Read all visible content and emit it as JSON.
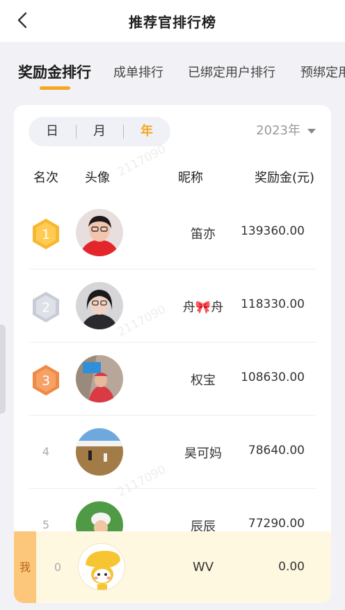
{
  "header": {
    "title": "推荐官排行榜"
  },
  "tabs": [
    {
      "label": "奖励金排行",
      "active": true
    },
    {
      "label": "成单排行",
      "active": false
    },
    {
      "label": "已绑定用户排行",
      "active": false
    },
    {
      "label": "预绑定用户排行",
      "active": false
    }
  ],
  "period": {
    "options": [
      "日",
      "月",
      "年"
    ],
    "selected": "年",
    "year": "2023年"
  },
  "table": {
    "headers": {
      "rank": "名次",
      "avatar": "头像",
      "nickname": "昵称",
      "amount": "奖励金(元)"
    },
    "rows": [
      {
        "rank": "1",
        "nickname": "笛亦",
        "amount": "139360.00"
      },
      {
        "rank": "2",
        "nickname": "舟🎀舟",
        "amount": "118330.00"
      },
      {
        "rank": "3",
        "nickname": "权宝",
        "amount": "108630.00"
      },
      {
        "rank": "4",
        "nickname": "昊可妈",
        "amount": "78640.00"
      },
      {
        "rank": "5",
        "nickname": "辰辰",
        "amount": "77290.00"
      }
    ]
  },
  "me": {
    "tag": "我",
    "rank": "0",
    "nickname": "WV",
    "amount": "0.00"
  },
  "watermark": "2117090",
  "colors": {
    "accent": "#f5a623",
    "gold": "#f7b731",
    "silver": "#c9ccd6",
    "bronze": "#ee8a45",
    "mine_bg": "#fff8e1"
  }
}
